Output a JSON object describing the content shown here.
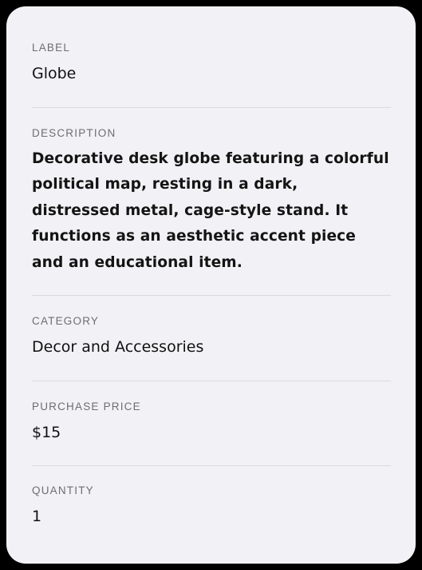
{
  "fields": {
    "label": {
      "title": "LABEL",
      "value": "Globe"
    },
    "description": {
      "title": "DESCRIPTION",
      "value": "Decorative desk globe featuring a colorful political map, resting in a dark, distressed metal, cage-style stand. It functions as an aesthetic accent piece and an educational item."
    },
    "category": {
      "title": "CATEGORY",
      "value": "Decor and Accessories"
    },
    "purchase_price": {
      "title": "PURCHASE PRICE",
      "value": "$15"
    },
    "quantity": {
      "title": "QUANTITY",
      "value": "1"
    }
  }
}
